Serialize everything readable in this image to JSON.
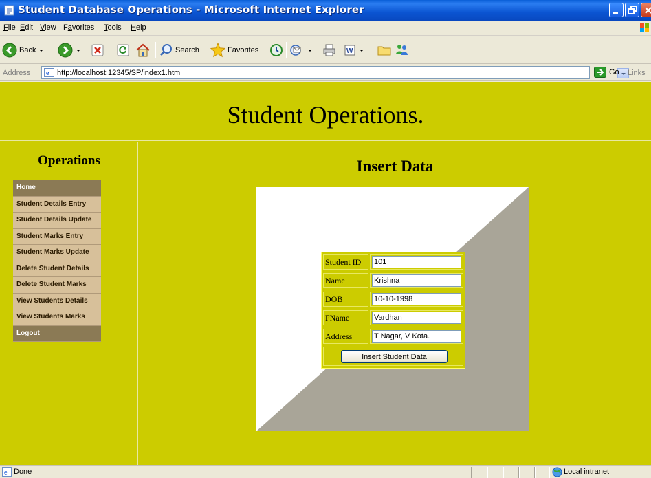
{
  "window": {
    "title": "Student Database Operations - Microsoft Internet Explorer",
    "icon": "ie-page-icon"
  },
  "menubar": {
    "items": [
      {
        "label": "File",
        "u": "F",
        "rest": "ile"
      },
      {
        "label": "Edit",
        "u": "E",
        "rest": "dit"
      },
      {
        "label": "View",
        "u": "V",
        "rest": "iew"
      },
      {
        "label": "Favorites",
        "pre": "F",
        "u": "a",
        "rest": "vorites"
      },
      {
        "label": "Tools",
        "u": "T",
        "rest": "ools"
      },
      {
        "label": "Help",
        "u": "H",
        "rest": "elp"
      }
    ]
  },
  "toolbar": {
    "back_label": "Back",
    "search_label": "Search",
    "favorites_label": "Favorites"
  },
  "address": {
    "label": "Address",
    "url": "http://localhost:12345/SP/index1.htm",
    "go_label": "Go",
    "links_label": "Links"
  },
  "page": {
    "heading": "Student Operations.",
    "sidebar_title": "Operations",
    "menu": [
      "Home",
      "Student Details Entry",
      "Student Details Update",
      "Student Marks Entry",
      "Student Marks Update",
      "Delete Student Details",
      "Delete Student Marks",
      "View Students Details",
      "View Students Marks",
      "Logout"
    ],
    "main_title": "Insert Data",
    "form": {
      "fields": [
        {
          "label": "Student ID",
          "value": "101"
        },
        {
          "label": "Name",
          "value": "Krishna"
        },
        {
          "label": "DOB",
          "value": "10-10-1998"
        },
        {
          "label": "FName",
          "value": "Vardhan"
        },
        {
          "label": "Address",
          "value": "T Nagar, V Kota."
        }
      ],
      "submit_label": "Insert Student Data"
    }
  },
  "status": {
    "text": "Done",
    "zone": "Local intranet"
  },
  "colors": {
    "page_bg": "#cccc00",
    "menu_item": "#d7c09a",
    "menu_item_dark": "#8b7a55",
    "panel_shadow": "#a9a598"
  }
}
